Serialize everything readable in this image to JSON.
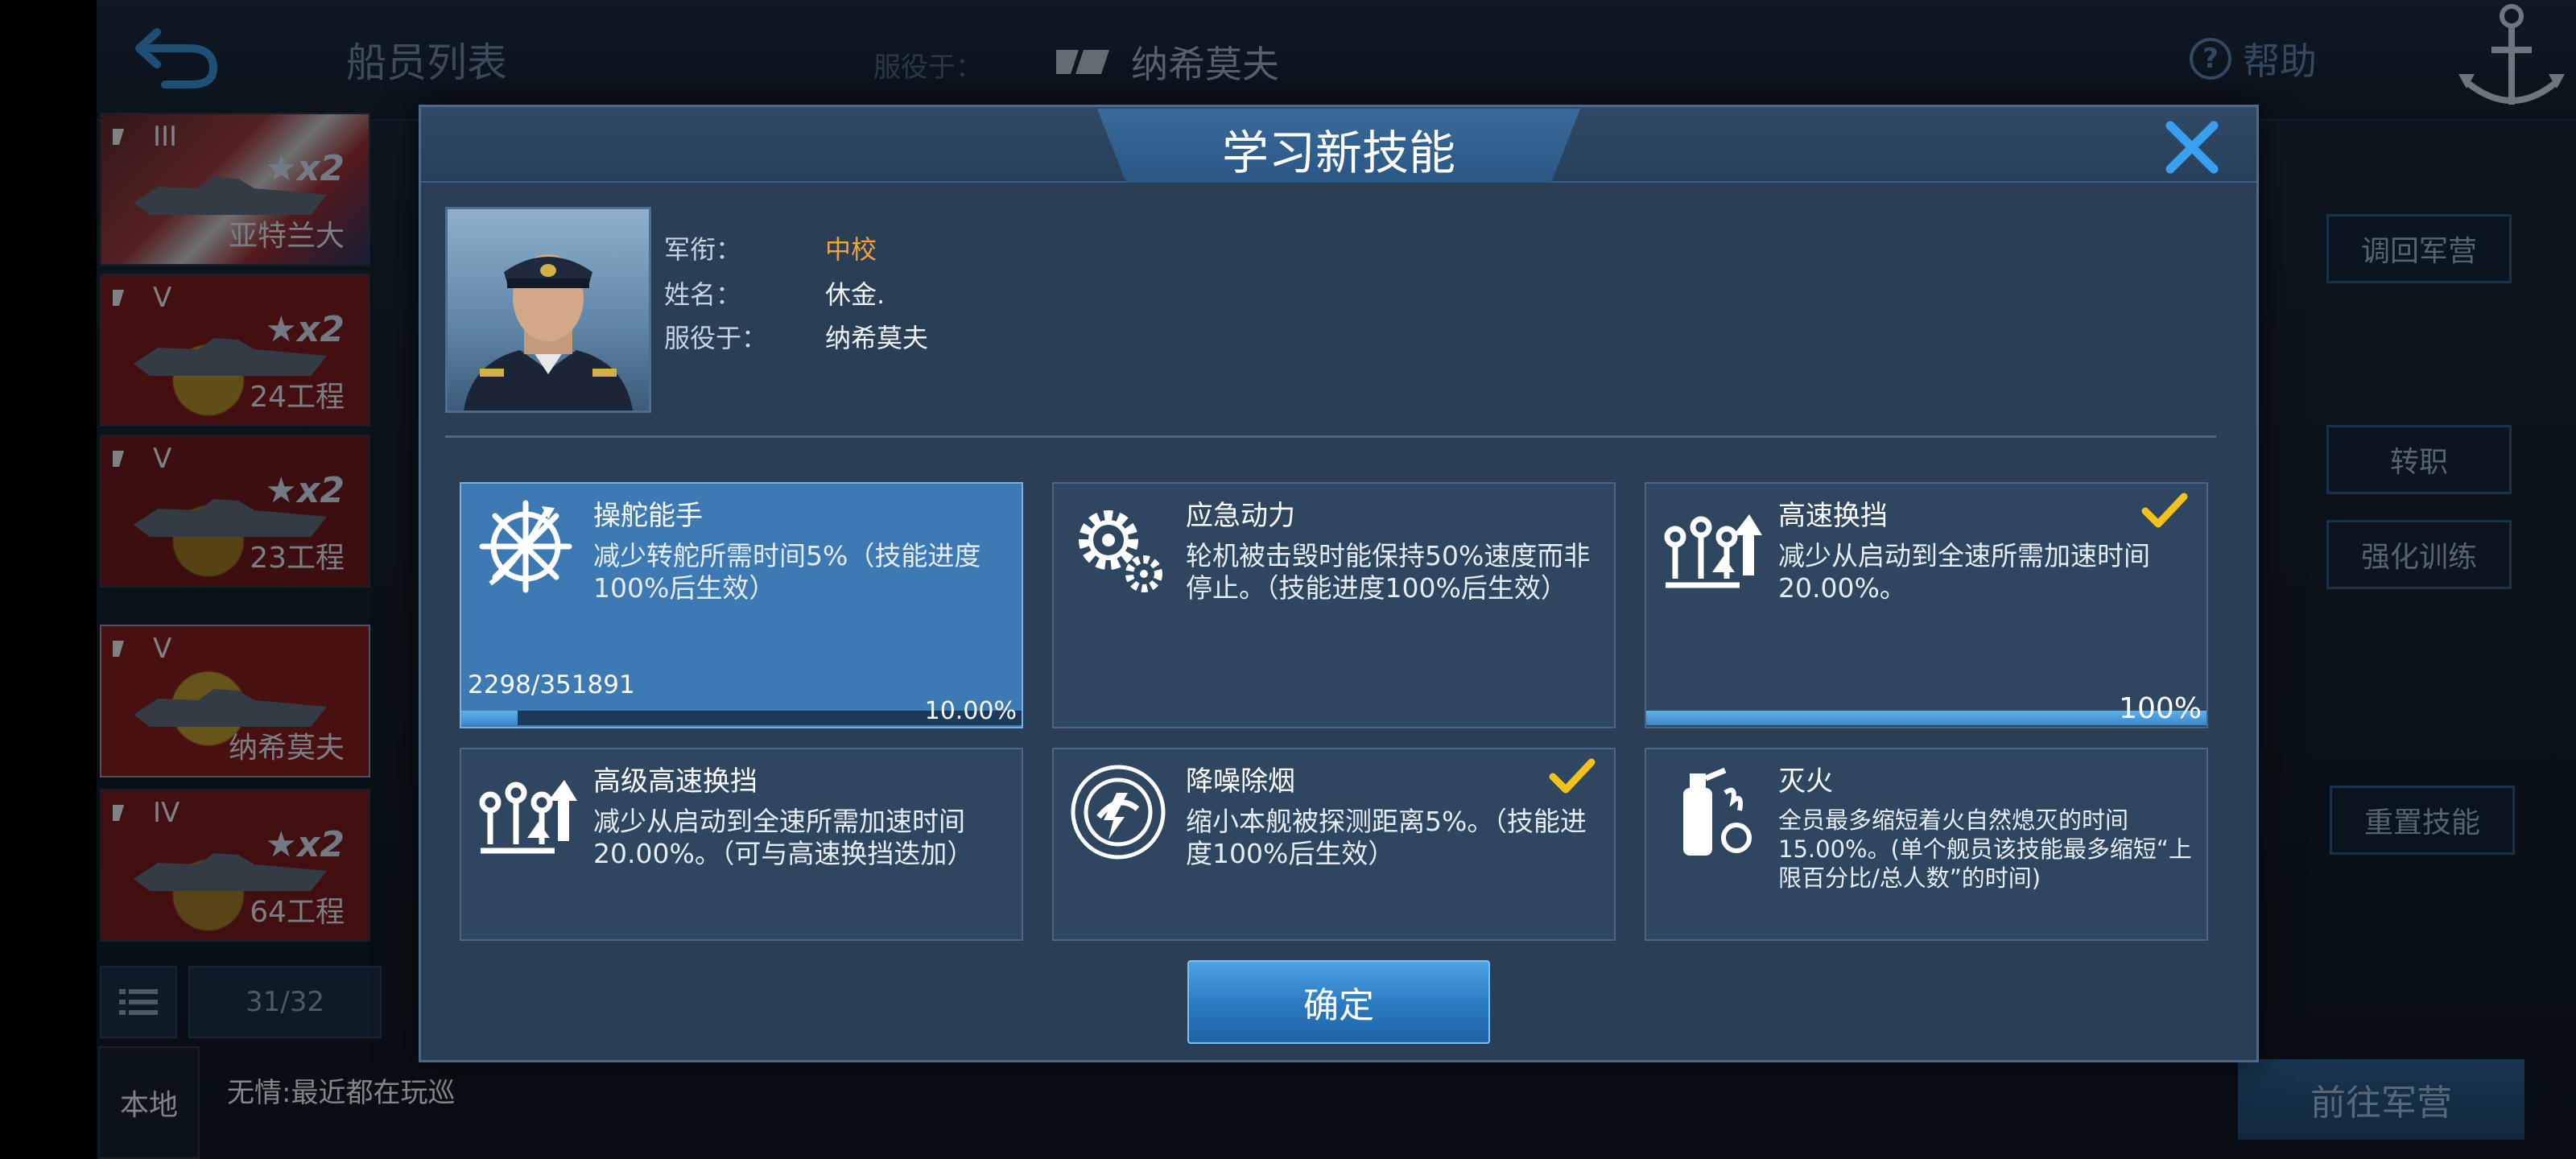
{
  "header": {
    "title": "船员列表",
    "served_label": "服役于：",
    "served_ship": "纳希莫夫",
    "help_label": "帮助"
  },
  "ship_list": {
    "items": [
      {
        "tier": "III",
        "stars": "★x2",
        "name": "亚特兰大",
        "flag_color": "#8e2a2a"
      },
      {
        "tier": "V",
        "stars": "★x2",
        "name": "24工程",
        "flag_color": "#8e1c1c"
      },
      {
        "tier": "V",
        "stars": "★x2",
        "name": "23工程",
        "flag_color": "#7d1a1a"
      },
      {
        "tier": "V",
        "stars": "",
        "name": "纳希莫夫",
        "flag_color": "#9a1e1e"
      },
      {
        "tier": "IV",
        "stars": "★x2",
        "name": "64工程",
        "flag_color": "#8a1c1c"
      }
    ],
    "count": "31/32"
  },
  "background_buttons": {
    "recall": "调回军营",
    "transfer": "转职",
    "enhance": "强化训练",
    "reset_skill": "重置技能",
    "goto_barracks": "前往军营"
  },
  "chat": {
    "channel": "本地",
    "message": "无情:最近都在玩巡"
  },
  "modal": {
    "title": "学习新技能",
    "officer": {
      "rank_label": "军衔：",
      "rank_value": "中校",
      "name_label": "姓名：",
      "name_value": "休金.",
      "served_label": "服役于：",
      "served_value": "纳希莫夫"
    },
    "skills": [
      {
        "name": "操舵能手",
        "desc": "减少转舵所需时间5%（技能进度100%后生效）",
        "icon": "helm-icon",
        "progress_text": "2298/351891",
        "progress_pct": "10.00%",
        "progress": 0.1,
        "selected": true,
        "learned": false
      },
      {
        "name": "应急动力",
        "desc": "轮机被击毁时能保持50%速度而非停止。（技能进度100%后生效）",
        "icon": "gears-icon",
        "selected": false,
        "learned": false
      },
      {
        "name": "高速换挡",
        "desc": "减少从启动到全速所需加速时间20.00%。",
        "icon": "gear-shift-icon",
        "progress_pct": "100%",
        "progress": 1.0,
        "selected": false,
        "learned": true
      },
      {
        "name": "高级高速换挡",
        "desc": "减少从启动到全速所需加速时间20.00%。（可与高速换挡迭加）",
        "icon": "gear-shift-icon",
        "selected": false,
        "learned": false
      },
      {
        "name": "降噪除烟",
        "desc": "缩小本舰被探测距离5%。（技能进度100%后生效）",
        "icon": "smoke-icon",
        "selected": false,
        "learned": true
      },
      {
        "name": "灭火",
        "desc": "全员最多缩短着火自然熄灭的时间15.00%。(单个舰员该技能最多缩短“上限百分比/总人数”的时间)",
        "icon": "extinguisher-icon",
        "selected": false,
        "learned": false
      }
    ],
    "confirm_label": "确定"
  },
  "colors": {
    "accent": "#3d79b3",
    "rank": "#f2a43a",
    "check": "#f2c21a"
  }
}
